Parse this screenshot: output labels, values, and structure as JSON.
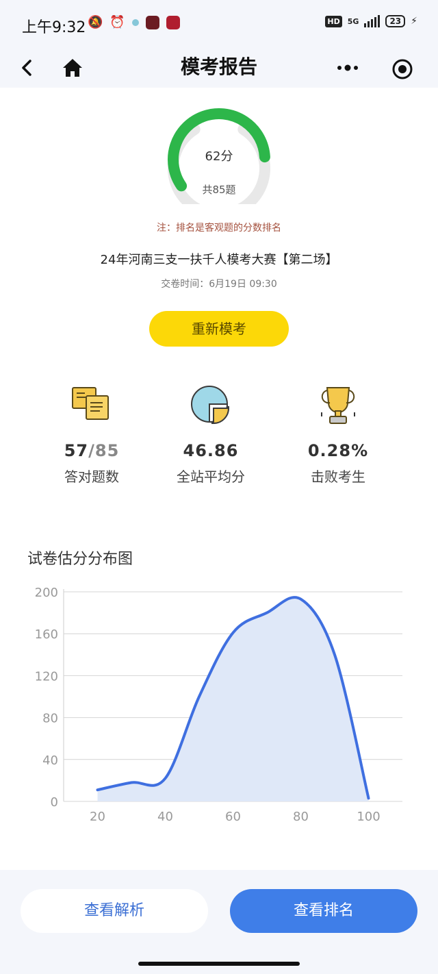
{
  "status_bar": {
    "time": "上午9:32",
    "network": "5G",
    "hd": "HD",
    "battery": "23"
  },
  "nav": {
    "title": "模考报告"
  },
  "score": {
    "score_text": "62分",
    "total_text": "共85题",
    "progress_fraction": 0.73
  },
  "note": "注：排名是客观题的分数排名",
  "exam": {
    "name": "24年河南三支一扶千人模考大赛【第二场】",
    "submit_time": "交卷时间：6月19日 09:30"
  },
  "retake_label": "重新模考",
  "stats": [
    {
      "value_main": "57",
      "value_sub": "/85",
      "label": "答对题数",
      "icon": "documents-icon"
    },
    {
      "value_main": "46.86",
      "value_sub": "",
      "label": "全站平均分",
      "icon": "pie-chart-icon"
    },
    {
      "value_main": "0.28%",
      "value_sub": "",
      "label": "击败考生",
      "icon": "trophy-icon"
    }
  ],
  "chart_title": "试卷估分分布图",
  "chart_data": {
    "type": "area",
    "x": [
      20,
      30,
      40,
      50,
      60,
      70,
      80,
      90,
      100
    ],
    "series": [
      {
        "values": [
          11,
          18,
          22,
          100,
          161,
          180,
          193,
          140,
          3
        ]
      }
    ],
    "xticks": [
      20,
      40,
      60,
      80,
      100
    ],
    "yticks": [
      0,
      40,
      80,
      120,
      160,
      200
    ],
    "xlim": [
      10,
      110
    ],
    "ylim": [
      0,
      200
    ],
    "grid": true,
    "colors": {
      "line": "#3f6fe0",
      "fill": "#dfe8f8"
    }
  },
  "buttons": {
    "analysis": "查看解析",
    "ranking": "查看排名"
  }
}
